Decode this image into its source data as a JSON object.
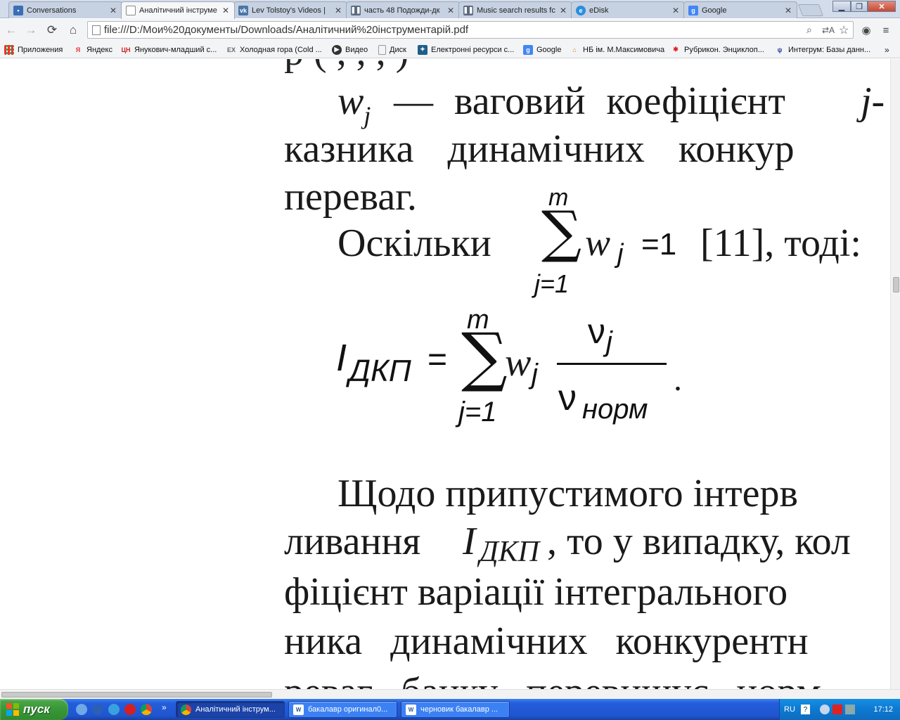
{
  "browser": {
    "tabs": [
      {
        "label": "Conversations",
        "icon": "chat-icon",
        "color": "#3a6fb5",
        "active": false
      },
      {
        "label": "Аналітичний інструме",
        "icon": "document-icon",
        "color": "#ffffff",
        "active": true
      },
      {
        "label": "Lev Tolstoy's Videos |",
        "icon": "vk-icon",
        "color": "#4a76a8",
        "active": false
      },
      {
        "label": "часть 48 Подожди-дк",
        "icon": "pause-icon",
        "color": "#5b6b80",
        "active": false
      },
      {
        "label": "Music search results fc",
        "icon": "pause-icon",
        "color": "#5b6b80",
        "active": false
      },
      {
        "label": "eDisk",
        "icon": "edisk-icon",
        "color": "#2b8de0",
        "active": false
      },
      {
        "label": "Google",
        "icon": "google-icon",
        "color": "#4285f4",
        "active": false
      }
    ],
    "url": "file:///D:/Мои%20документы/Downloads/Аналітичний%20інструментарій.pdf",
    "bookmarks": [
      {
        "label": "Приложения",
        "icon": "apps-icon"
      },
      {
        "label": "Яндекс",
        "icon": "yandex-icon"
      },
      {
        "label": "Янукович-младший с...",
        "icon": "news-icon"
      },
      {
        "label": "Холодная гора (Cold ...",
        "icon": "ex-icon"
      },
      {
        "label": "Видео",
        "icon": "video-icon"
      },
      {
        "label": "Диск",
        "icon": "page-icon"
      },
      {
        "label": "Електронні ресурси с...",
        "icon": "library-icon"
      },
      {
        "label": "Google",
        "icon": "google-icon"
      },
      {
        "label": "НБ ім. М.Максимовича",
        "icon": "building-icon"
      },
      {
        "label": "Рубрикон. Энциклоп...",
        "icon": "rubricon-icon"
      },
      {
        "label": "Интегрум: Базы данн...",
        "icon": "integrum-icon"
      }
    ]
  },
  "pdf": {
    "line1_var": "w",
    "line1_sub": "j",
    "line1_text": "— ваговий коефіцієнт",
    "line1_end": "j-",
    "line2": "казника динамічних конкур",
    "line3": "переваг.",
    "line4_start": "Оскільки",
    "line4_end": "[11], тоді:",
    "sum1": {
      "top": "m",
      "var": "w",
      "sub": "j",
      "eq": "=1",
      "bottom": "j=1"
    },
    "formula": {
      "lhs": "I",
      "lhs_sub": "ДКП",
      "eq": "=",
      "top": "m",
      "bottom": "j=1",
      "w": "w",
      "w_sub": "j",
      "num": "ν",
      "num_sub": "j",
      "den": "ν",
      "den_sub": "норм",
      "period": "."
    },
    "para2_line1": "Щодо припустимого інтерв",
    "para2_line2_start": "ливання",
    "para2_line2_var": "I",
    "para2_line2_sub": "ДКП",
    "para2_line2_end": ", то у випадку, кол",
    "para2_line3": "фіцієнт варіації інтегрального",
    "para2_line4": "ника динамічних конкурентн",
    "para2_line5": "реваг банку перевищує норм"
  },
  "taskbar": {
    "start_label": "пуск",
    "tasks": [
      {
        "label": "Аналітичний інструм...",
        "icon": "chrome-icon",
        "active": true
      },
      {
        "label": "бакалавр оригинал0...",
        "icon": "word-icon",
        "active": false
      },
      {
        "label": "черновик бакалавр ...",
        "icon": "word-icon",
        "active": false
      }
    ],
    "lang": "RU",
    "clock": "17:12"
  }
}
